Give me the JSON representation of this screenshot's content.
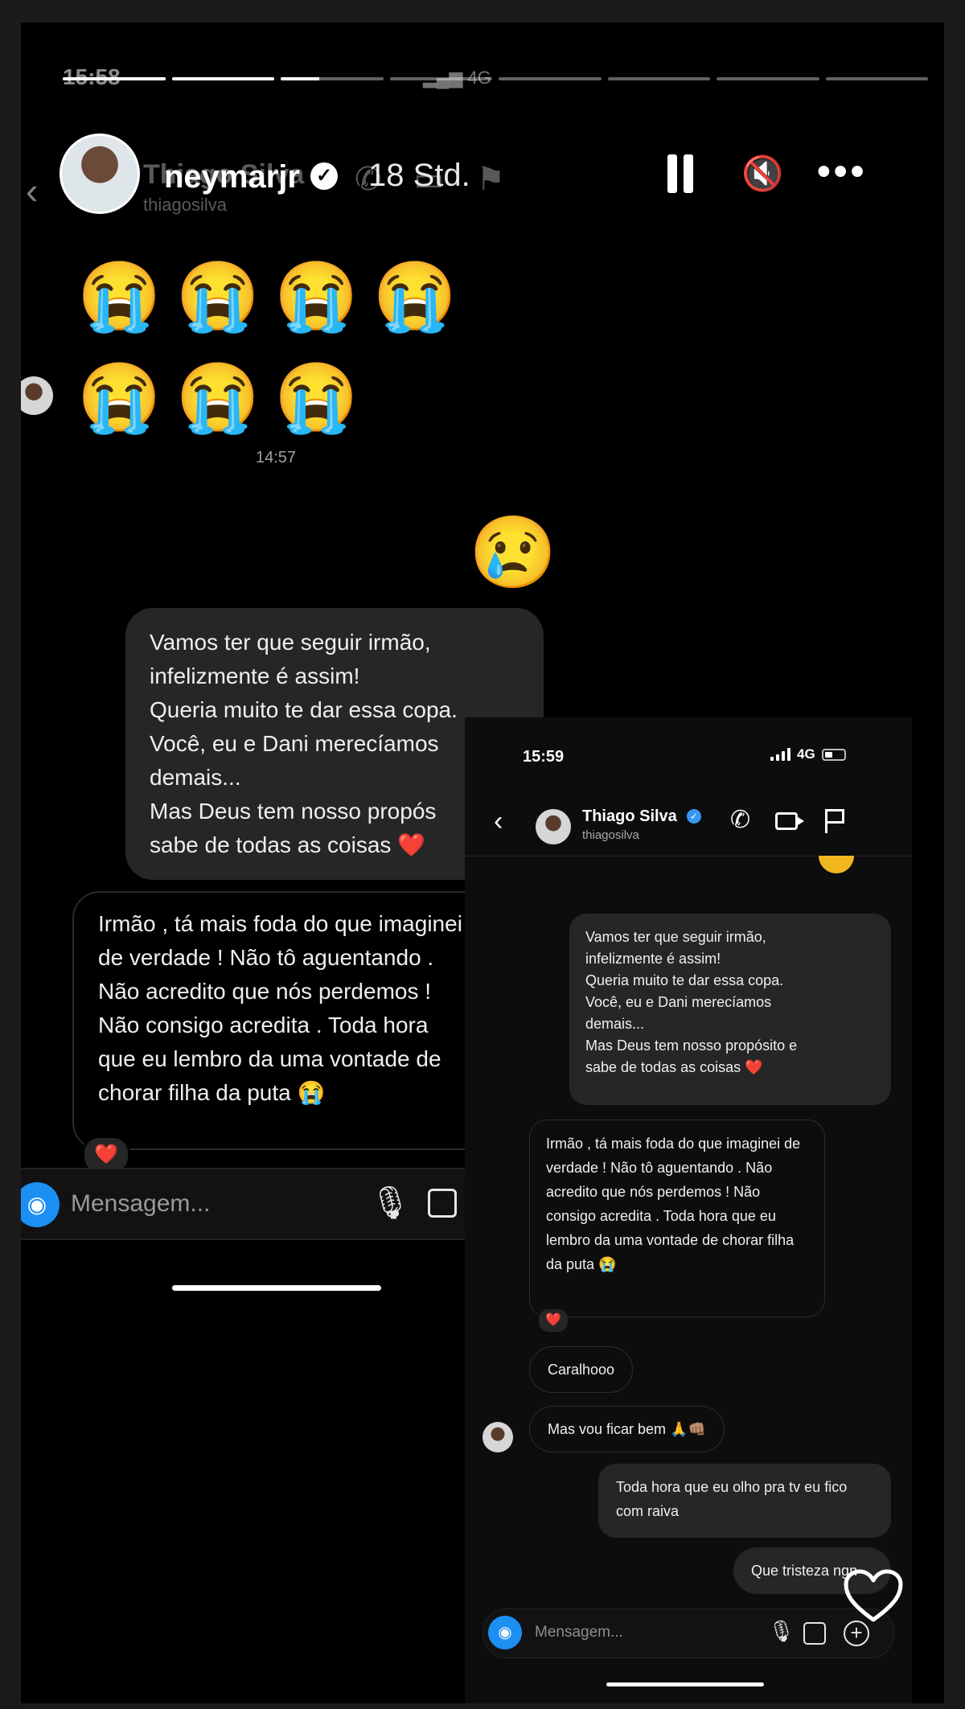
{
  "background_status": {
    "time": "15:58",
    "signal": "4G"
  },
  "progress": {
    "segments": 8,
    "filled": [
      1,
      1,
      0.38,
      0,
      0,
      0,
      0,
      0
    ]
  },
  "story": {
    "username": "neymarjr",
    "verified_icon": "verified-badge-icon",
    "time_ago": "18 Std."
  },
  "chat1": {
    "background_header": {
      "name": "Thiago Silva",
      "handle": "thiagosilva"
    },
    "emoji_row1": [
      "😭",
      "😭",
      "😭",
      "😭"
    ],
    "emoji_row2": [
      "😭",
      "😭",
      "😭"
    ],
    "timestamp": "14:57",
    "sad_emoji": "😢",
    "outgoing_lines": [
      "Vamos ter que seguir irmão,",
      "infelizmente é assim!",
      "Queria muito te dar essa copa.",
      "Você, eu e Dani merecíamos",
      "demais...",
      "Mas Deus tem nosso propós",
      "sabe de todas as coisas ❤️"
    ],
    "incoming_text": "Irmão , tá mais foda do que imaginei de verdade ! Não tô aguentando . Não acredito que nós perdemos ! Não consigo acredita . Toda hora que eu lembro da uma vontade de chorar filha da puta 😭",
    "reaction": "❤️",
    "composer_placeholder": "Mensagem..."
  },
  "chat2": {
    "status_time": "15:59",
    "status_network": "4G",
    "contact_name": "Thiago Silva",
    "contact_handle": "thiagosilva",
    "outgoing1_lines": [
      "Vamos ter que seguir irmão,",
      "infelizmente é assim!",
      "Queria muito te dar essa copa.",
      "Você, eu e Dani merecíamos",
      "demais...",
      "Mas Deus tem nosso propósito e",
      "sabe de todas as coisas ❤️"
    ],
    "incoming1_text": "Irmão , tá mais foda do que imaginei de verdade ! Não tô aguentando . Não acredito que nós perdemos ! Não consigo acredita . Toda hora que eu lembro da uma vontade de chorar filha da puta 😭",
    "reaction": "❤️",
    "incoming2": "Caralhooo",
    "incoming3": "Mas vou ficar bem 🙏👊🏽",
    "outgoing2": "Toda hora que eu olho pra tv eu fico com raiva",
    "outgoing3": "Que tristeza ngn",
    "composer_placeholder": "Mensagem..."
  }
}
